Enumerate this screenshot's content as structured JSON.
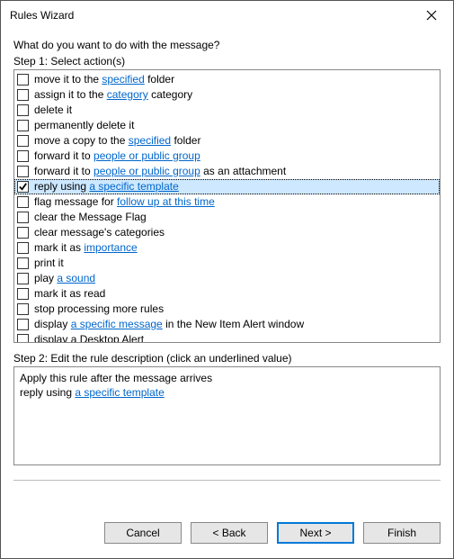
{
  "title": "Rules Wizard",
  "question": "What do you want to do with the message?",
  "step1_label": "Step 1: Select action(s)",
  "actions": [
    {
      "checked": false,
      "selected": false,
      "parts": [
        {
          "t": "move it to the "
        },
        {
          "t": "specified",
          "link": true
        },
        {
          "t": " folder"
        }
      ]
    },
    {
      "checked": false,
      "selected": false,
      "parts": [
        {
          "t": "assign it to the "
        },
        {
          "t": "category",
          "link": true
        },
        {
          "t": " category"
        }
      ]
    },
    {
      "checked": false,
      "selected": false,
      "parts": [
        {
          "t": "delete it"
        }
      ]
    },
    {
      "checked": false,
      "selected": false,
      "parts": [
        {
          "t": "permanently delete it"
        }
      ]
    },
    {
      "checked": false,
      "selected": false,
      "parts": [
        {
          "t": "move a copy to the "
        },
        {
          "t": "specified",
          "link": true
        },
        {
          "t": " folder"
        }
      ]
    },
    {
      "checked": false,
      "selected": false,
      "parts": [
        {
          "t": "forward it to "
        },
        {
          "t": "people or public group",
          "link": true
        }
      ]
    },
    {
      "checked": false,
      "selected": false,
      "parts": [
        {
          "t": "forward it to "
        },
        {
          "t": "people or public group",
          "link": true
        },
        {
          "t": " as an attachment"
        }
      ]
    },
    {
      "checked": true,
      "selected": true,
      "parts": [
        {
          "t": "reply using "
        },
        {
          "t": "a specific template",
          "link": true
        }
      ]
    },
    {
      "checked": false,
      "selected": false,
      "parts": [
        {
          "t": "flag message for "
        },
        {
          "t": "follow up at this time",
          "link": true
        }
      ]
    },
    {
      "checked": false,
      "selected": false,
      "parts": [
        {
          "t": "clear the Message Flag"
        }
      ]
    },
    {
      "checked": false,
      "selected": false,
      "parts": [
        {
          "t": "clear message's categories"
        }
      ]
    },
    {
      "checked": false,
      "selected": false,
      "parts": [
        {
          "t": "mark it as "
        },
        {
          "t": "importance",
          "link": true
        }
      ]
    },
    {
      "checked": false,
      "selected": false,
      "parts": [
        {
          "t": "print it"
        }
      ]
    },
    {
      "checked": false,
      "selected": false,
      "parts": [
        {
          "t": "play "
        },
        {
          "t": "a sound",
          "link": true
        }
      ]
    },
    {
      "checked": false,
      "selected": false,
      "parts": [
        {
          "t": "mark it as read"
        }
      ]
    },
    {
      "checked": false,
      "selected": false,
      "parts": [
        {
          "t": "stop processing more rules"
        }
      ]
    },
    {
      "checked": false,
      "selected": false,
      "parts": [
        {
          "t": "display "
        },
        {
          "t": "a specific message",
          "link": true
        },
        {
          "t": " in the New Item Alert window"
        }
      ]
    },
    {
      "checked": false,
      "selected": false,
      "parts": [
        {
          "t": "display a Desktop Alert"
        }
      ]
    }
  ],
  "step2_label": "Step 2: Edit the rule description (click an underlined value)",
  "description": {
    "line1": "Apply this rule after the message arrives",
    "line2_prefix": "reply using ",
    "line2_link": "a specific template"
  },
  "buttons": {
    "cancel": "Cancel",
    "back": "< Back",
    "next": "Next >",
    "finish": "Finish"
  }
}
